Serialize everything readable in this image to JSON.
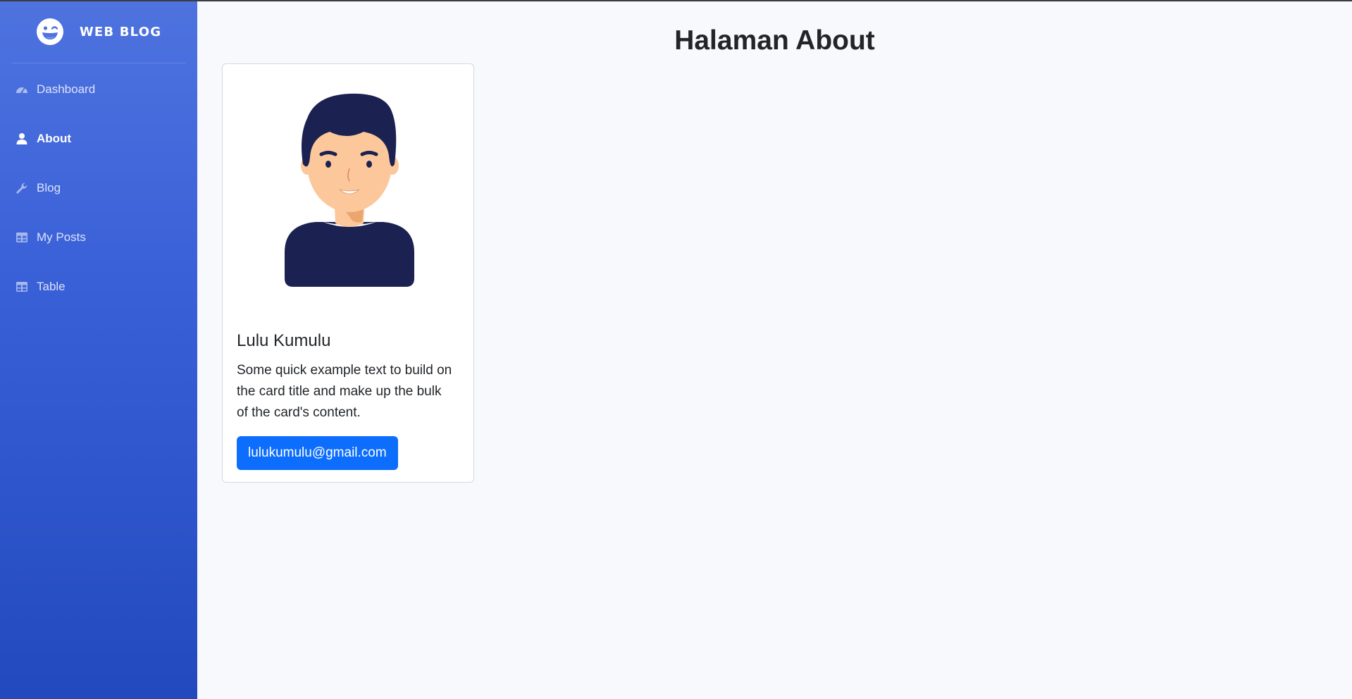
{
  "sidebar": {
    "brand": {
      "icon": "laugh-wink-icon",
      "text": "WEB BLOG"
    },
    "items": [
      {
        "label": "Dashboard",
        "icon": "tachometer-icon",
        "active": false
      },
      {
        "label": "About",
        "icon": "user-icon",
        "active": true
      },
      {
        "label": "Blog",
        "icon": "wrench-icon",
        "active": false
      },
      {
        "label": "My Posts",
        "icon": "table-icon",
        "active": false
      },
      {
        "label": "Table",
        "icon": "table-icon",
        "active": false
      }
    ]
  },
  "main": {
    "title": "Halaman About",
    "card": {
      "avatar": "user-avatar-illustration",
      "name": "Lulu Kumulu",
      "text": "Some quick example text to build on the card title and make up the bulk of the card's content.",
      "button_label": "lulukumulu@gmail.com"
    }
  },
  "colors": {
    "sidebar_top": "#4e73df",
    "sidebar_bottom": "#224abe",
    "primary_button": "#0d6efd",
    "page_background": "#f8f9fc"
  }
}
